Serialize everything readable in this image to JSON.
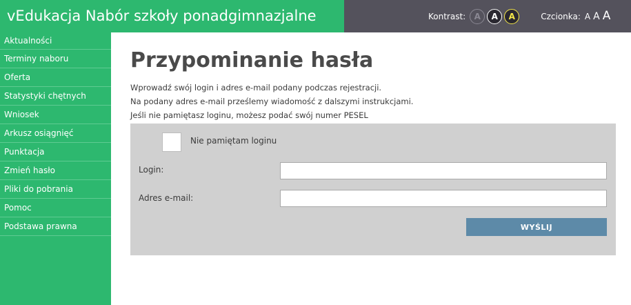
{
  "header": {
    "title": "vEdukacja Nabór szkoły ponadgimnazjalne",
    "contrast_label": "Kontrast:",
    "contrast_options": [
      "A",
      "A",
      "A"
    ],
    "font_label": "Czcionka:",
    "font_sizes": [
      "A",
      "A",
      "A"
    ]
  },
  "sidebar": {
    "items": [
      {
        "label": "Aktualności"
      },
      {
        "label": "Terminy naboru"
      },
      {
        "label": "Oferta"
      },
      {
        "label": "Statystyki chętnych"
      },
      {
        "label": "Wniosek"
      },
      {
        "label": "Arkusz osiągnięć"
      },
      {
        "label": "Punktacja"
      },
      {
        "label": "Zmień hasło"
      },
      {
        "label": "Pliki do pobrania"
      },
      {
        "label": "Pomoc"
      },
      {
        "label": "Podstawa prawna"
      }
    ]
  },
  "main": {
    "title": "Przypominanie hasła",
    "intro": [
      "Wprowadź swój login i adres e-mail podany podczas rejestracji.",
      "Na podany adres e-mail prześlemy wiadomość z dalszymi instrukcjami.",
      "Jeśli nie pamiętasz loginu, możesz podać swój numer PESEL"
    ],
    "form": {
      "checkbox_label": "Nie pamiętam loginu",
      "checkbox_checked": false,
      "login_label": "Login:",
      "login_value": "",
      "email_label": "Adres e-mail:",
      "email_value": "",
      "submit_label": "WYŚLIJ"
    }
  },
  "colors": {
    "brand_green": "#2db86f",
    "toolbar_dark": "#54525c",
    "form_bg": "#d0d0d0",
    "button_blue": "#5d8aa8",
    "contrast_yellow": "#f5e84a"
  }
}
